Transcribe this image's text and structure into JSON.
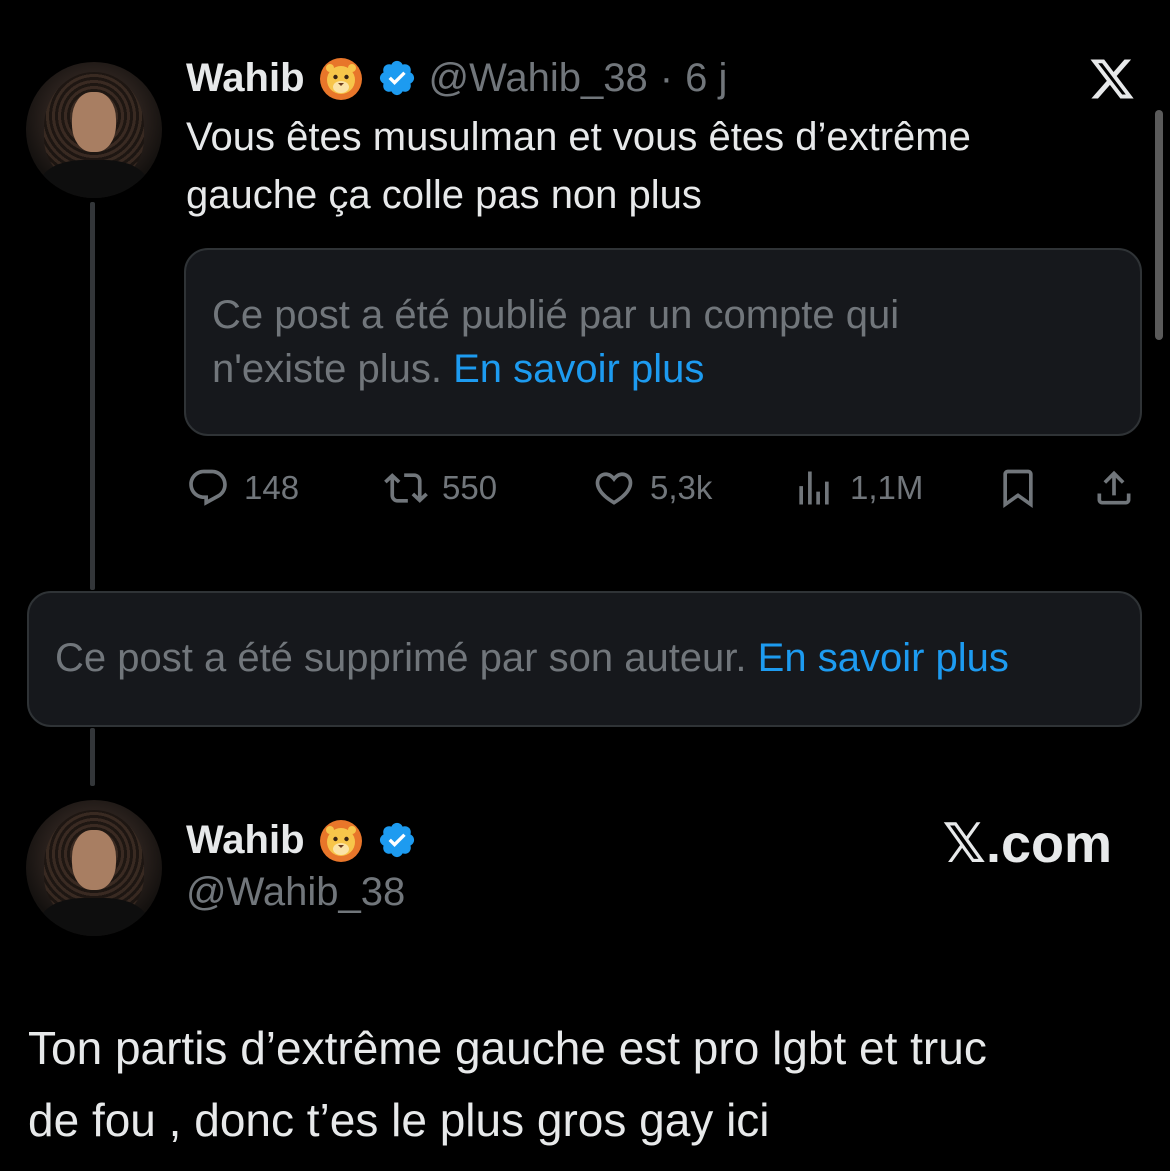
{
  "tweet1": {
    "name": "Wahib",
    "handle": "@Wahib_38",
    "separator": "·",
    "time": "6 j",
    "text_line1": "Vous êtes musulman et vous êtes d’extrême",
    "text_line2": "gauche ça colle pas non plus",
    "quote_notice_line1": "Ce post a été publié par un compte qui",
    "quote_notice_line2": "n'existe plus.",
    "quote_notice_link": "En savoir plus",
    "actions": {
      "replies": "148",
      "reposts": "550",
      "likes": "5,3k",
      "views": "1,1M"
    }
  },
  "deleted_notice": {
    "text": "Ce post a été supprimé par son auteur.",
    "link": "En savoir plus"
  },
  "tweet2": {
    "name": "Wahib",
    "handle": "@Wahib_38",
    "watermark": "𝕏.com",
    "text_line1": "Ton partis d’extrême gauche est pro lgbt et truc",
    "text_line2": "de fou , donc t’es le plus gros gay ici"
  },
  "icons": {
    "close": "x-logo-icon",
    "verified": "verified-badge-icon",
    "emoji": "lion-emoji-icon",
    "reply": "reply-icon",
    "repost": "repost-icon",
    "like": "heart-icon",
    "views": "views-icon",
    "bookmark": "bookmark-icon",
    "share": "share-icon"
  },
  "colors": {
    "background": "#000000",
    "accent": "#1d9bf0",
    "muted": "#71767b",
    "text": "#e7e9ea"
  }
}
